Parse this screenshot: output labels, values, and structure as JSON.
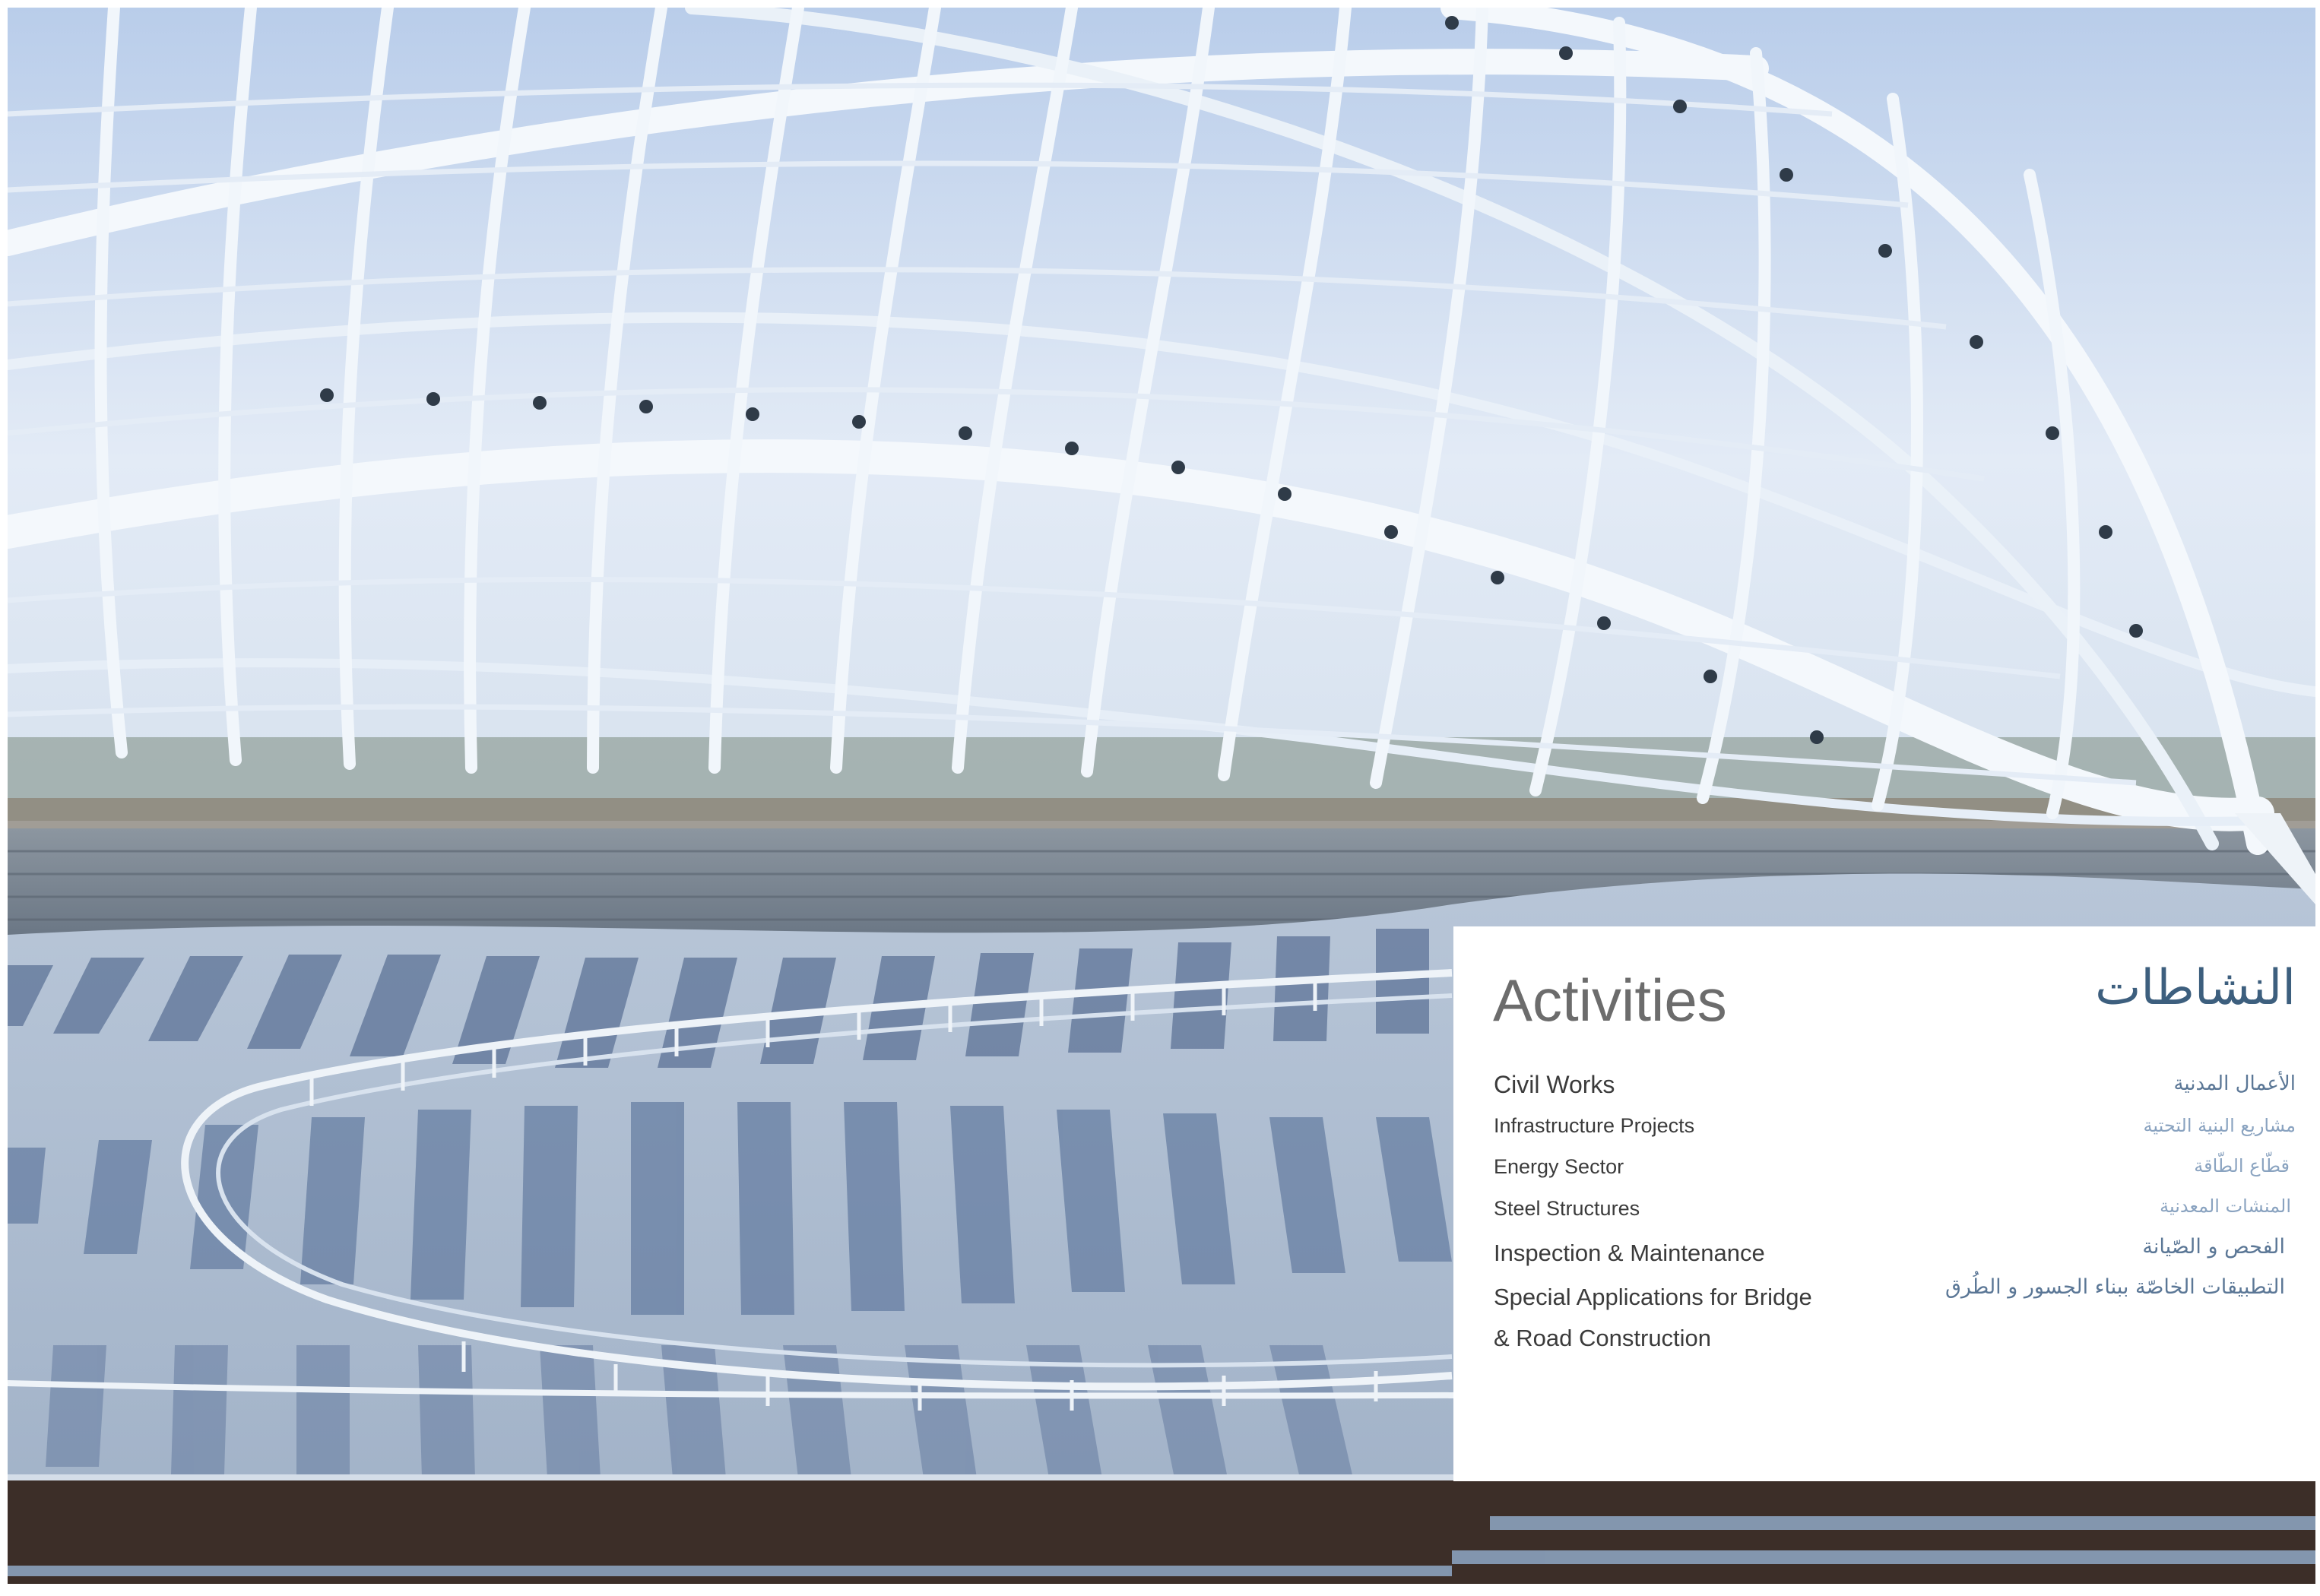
{
  "activities": {
    "title_en": "Activities",
    "title_ar": "النشاطات",
    "items_en": [
      "Civil Works",
      "Infrastructure Projects",
      "Energy Sector",
      "Steel Structures",
      "Inspection & Maintenance",
      "Special Applications for Bridge",
      "& Road Construction"
    ],
    "items_ar": [
      "الأعمال المدنية",
      "مشاريع البنية التحتية",
      "قطّاع الطّاقة",
      "المنشات المعدنية",
      "الفحص و الصّيانة",
      "التطبيقات الخاصّة ببناء الجسور و الطُرق"
    ]
  },
  "colors": {
    "sky": "#c8d9ef",
    "steel": "#f4f8fc",
    "shadow": "#6f86a8",
    "title_en": "#6c6c6c",
    "title_ar": "#3d5f7e",
    "item_ar": "#6f8cad"
  }
}
